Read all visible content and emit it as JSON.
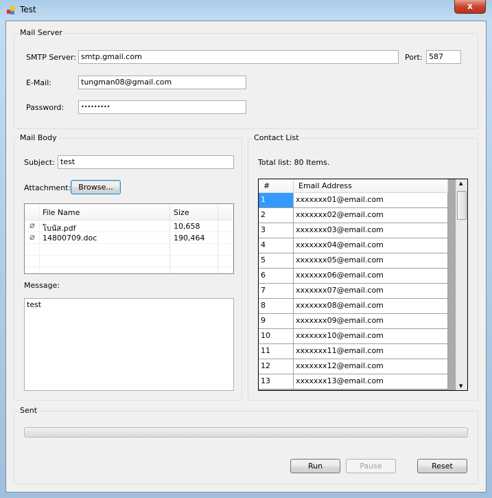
{
  "window": {
    "title": "Test",
    "close_glyph": "x"
  },
  "mail_server": {
    "legend": "Mail Server",
    "smtp_label": "SMTP Server:",
    "smtp_value": "smtp.gmail.com",
    "port_label": "Port:",
    "port_value": "587",
    "email_label": "E-Mail:",
    "email_value": "tungman08@gmail.com",
    "password_label": "Password:",
    "password_value": "•••••••••"
  },
  "mail_body": {
    "legend": "Mail Body",
    "subject_label": "Subject:",
    "subject_value": "test",
    "attachment_label": "Attachment:",
    "browse_label": "Browse...",
    "attachments": {
      "columns": [
        "File Name",
        "Size"
      ],
      "rows": [
        {
          "name": "โบนัส.pdf",
          "size": "10,658"
        },
        {
          "name": "14800709.doc",
          "size": "190,464"
        }
      ]
    },
    "message_label": "Message:",
    "message_value": "test"
  },
  "contact_list": {
    "legend": "Contact List",
    "total": "Total list: 80 Items.",
    "columns": [
      "#",
      "Email Address"
    ],
    "rows": [
      {
        "n": "1",
        "email": "xxxxxxx01@email.com"
      },
      {
        "n": "2",
        "email": "xxxxxxx02@email.com"
      },
      {
        "n": "3",
        "email": "xxxxxxx03@email.com"
      },
      {
        "n": "4",
        "email": "xxxxxxx04@email.com"
      },
      {
        "n": "5",
        "email": "xxxxxxx05@email.com"
      },
      {
        "n": "6",
        "email": "xxxxxxx06@email.com"
      },
      {
        "n": "7",
        "email": "xxxxxxx07@email.com"
      },
      {
        "n": "8",
        "email": "xxxxxxx08@email.com"
      },
      {
        "n": "9",
        "email": "xxxxxxx09@email.com"
      },
      {
        "n": "10",
        "email": "xxxxxxx10@email.com"
      },
      {
        "n": "11",
        "email": "xxxxxxx11@email.com"
      },
      {
        "n": "12",
        "email": "xxxxxxx12@email.com"
      },
      {
        "n": "13",
        "email": "xxxxxxx13@email.com"
      }
    ],
    "selected_color": "#3399ff"
  },
  "sent": {
    "legend": "Sent",
    "progress": 0,
    "run_label": "Run",
    "pause_label": "Pause",
    "reset_label": "Reset"
  }
}
